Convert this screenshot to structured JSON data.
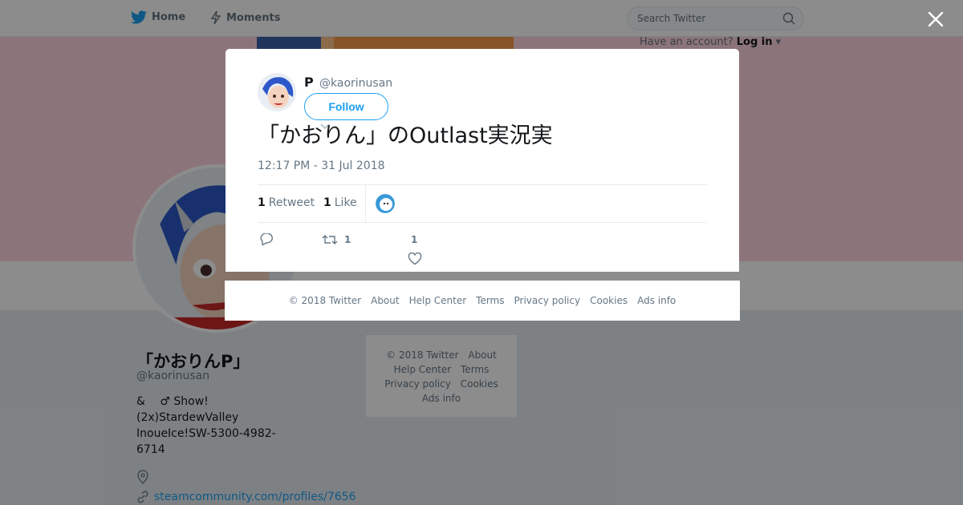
{
  "nav": {
    "home": "Home",
    "moments": "Moments",
    "search_placeholder": "Search Twitter",
    "account_prompt": "Have an account?",
    "login": "Log in"
  },
  "profile": {
    "name": "「かおりんP」",
    "handle": "@kaorinusan",
    "bio": [
      "& 　♂ Show!",
      "(2x)StardewValley",
      "InoueIce!SW-5300-4982-",
      "6714"
    ],
    "link": "steamcommunity.com/profiles/7656"
  },
  "side_footer": {
    "items": [
      "© 2018 Twitter",
      "About",
      "Help Center",
      "Terms",
      "Privacy policy",
      "Cookies",
      "Ads info"
    ]
  },
  "tweet": {
    "author_name": "P",
    "author_handle": "@kaorinusan",
    "follow_label": "Follow",
    "text": "「かおりん」のOutlast実況実",
    "timestamp": "12:17 PM - 31 Jul 2018",
    "retweet_count": "1",
    "retweet_label": "Retweet",
    "like_count": "1",
    "like_label": "Like",
    "action_retweet_count": "1",
    "action_like_count": "1"
  },
  "modal_footer": {
    "items": [
      "© 2018 Twitter",
      "About",
      "Help Center",
      "Terms",
      "Privacy policy",
      "Cookies",
      "Ads info"
    ]
  },
  "icons": {
    "brand": "twitter-bird-icon",
    "moments": "lightning-icon",
    "search": "search-icon",
    "close": "close-icon",
    "reply": "reply-icon",
    "retweet": "retweet-icon",
    "like": "heart-icon",
    "location": "location-icon",
    "link": "link-icon"
  },
  "colors": {
    "accent": "#1da1f2",
    "banner": "#ffd6de",
    "text_secondary": "#657786"
  }
}
